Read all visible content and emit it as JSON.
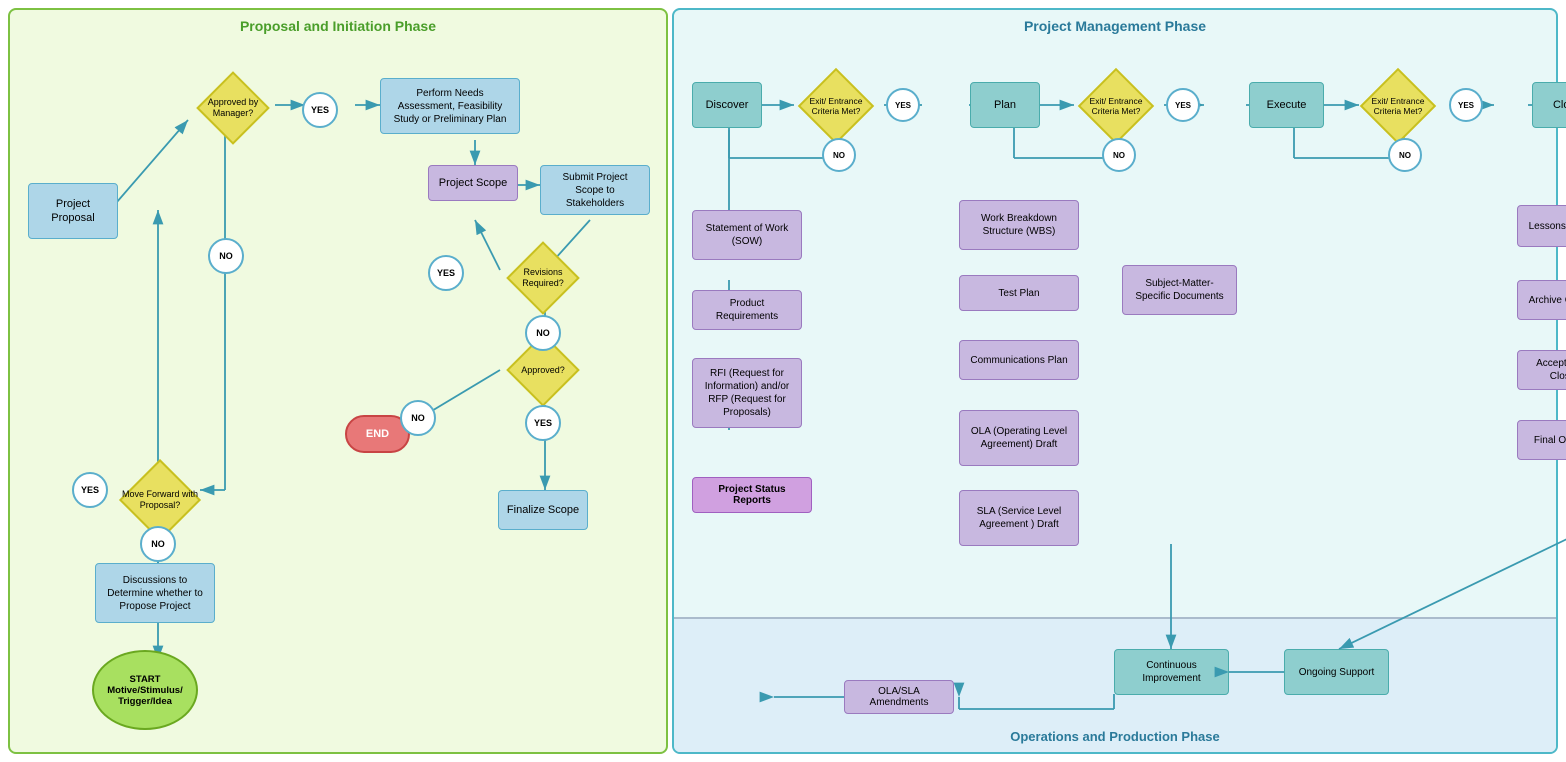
{
  "phases": {
    "left": {
      "title": "Proposal and Initiation Phase",
      "color": "#4a9e2a"
    },
    "right": {
      "title": "Project Management Phase",
      "color": "#2a7a9a"
    },
    "bottom": {
      "title": "Operations and Production Phase",
      "color": "#2a7a9a"
    }
  },
  "nodes": {
    "approved_by_manager": "Approved by Manager?",
    "yes1": "YES",
    "perform_needs": "Perform Needs Assessment, Feasibility Study or Preliminary Plan",
    "project_scope": "Project Scope",
    "submit_project_scope": "Submit Project Scope to Stakeholders",
    "revisions_required": "Revisions Required?",
    "yes2": "YES",
    "no_revisions": "NO",
    "approved": "Approved?",
    "no_approved": "NO",
    "yes_approved": "YES",
    "finalize_scope": "Finalize Scope",
    "end": "END",
    "no1": "NO",
    "move_forward": "Move Forward with Proposal?",
    "yes3": "YES",
    "no2": "NO",
    "discussions": "Discussions to Determine whether to Propose Project",
    "start": "START Motive/Stimulus/ Trigger/Idea",
    "project_proposal": "Project Proposal",
    "discover": "Discover",
    "exit1": "Exit/ Entrance Criteria Met?",
    "yes_e1": "YES",
    "no_e1": "NO",
    "plan": "Plan",
    "exit2": "Exit/ Entrance Criteria Met?",
    "yes_e2": "YES",
    "no_e2": "NO",
    "execute": "Execute",
    "exit3": "Exit/ Entrance Criteria Met?",
    "yes_e3": "YES",
    "no_e3": "NO",
    "close": "Close",
    "sow": "Statement of Work (SOW)",
    "product_req": "Product Requirements",
    "rfi": "RFI (Request for Information) and/or RFP (Request for Proposals)",
    "project_status": "Project Status Reports",
    "wbs": "Work Breakdown Structure (WBS)",
    "test_plan": "Test Plan",
    "subject_matter": "Subject-Matter-Specific Documents",
    "comm_plan": "Communications Plan",
    "ola_draft": "OLA (Operating Level Agreement) Draft",
    "sla_draft": "SLA (Service Level Agreement ) Draft",
    "lessons_learned": "Lessons Learned",
    "archive_checklist": "Archive Checklist",
    "acceptance": "Acceptance & Closure",
    "final_ola_sla": "Final OLA/SLA",
    "continuous_improvement": "Continuous Improvement",
    "ongoing_support": "Ongoing Support",
    "ola_sla_amendments": "OLA/SLA Amendments"
  }
}
